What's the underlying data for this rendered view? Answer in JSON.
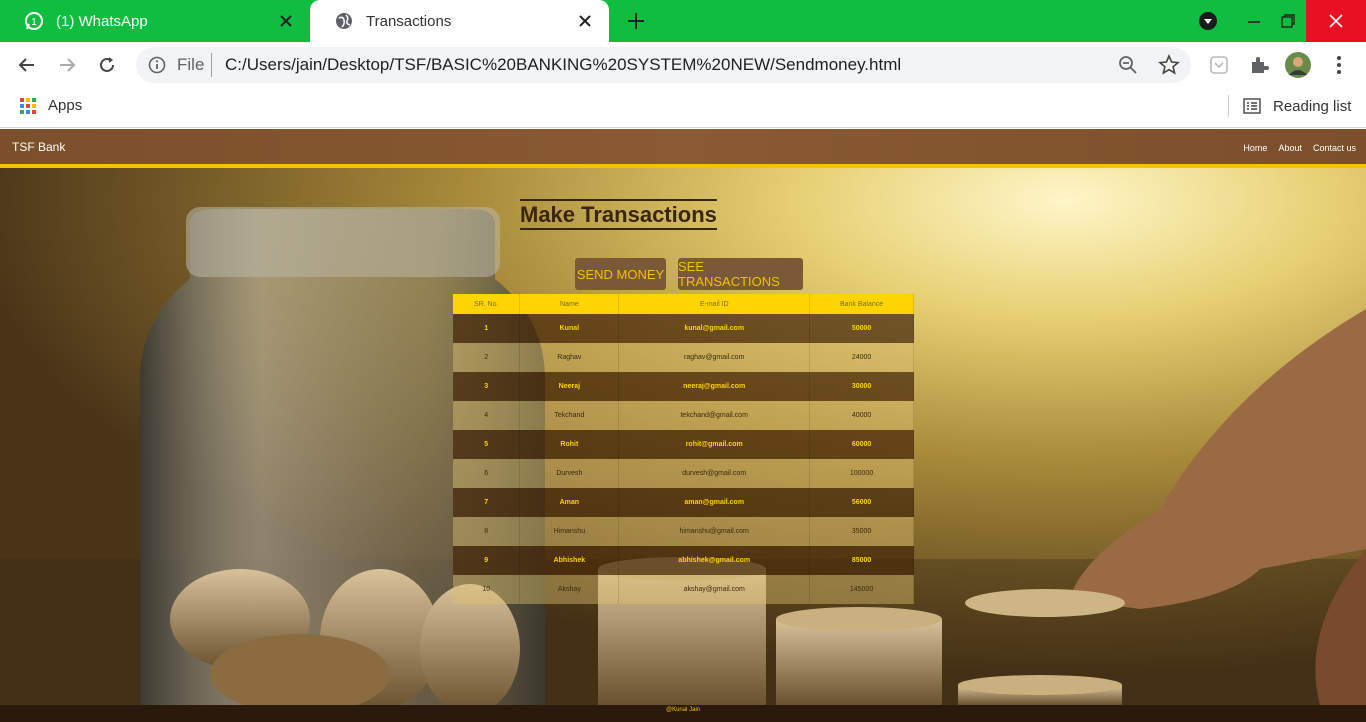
{
  "browser": {
    "tabs": [
      {
        "title": "(1) WhatsApp",
        "active": false
      },
      {
        "title": "Transactions",
        "active": true
      }
    ],
    "address": {
      "scheme": "File",
      "url": "C:/Users/jain/Desktop/TSF/BASIC%20BANKING%20SYSTEM%20NEW/Sendmoney.html"
    },
    "bookmarks": {
      "apps_label": "Apps",
      "reading_list_label": "Reading list"
    }
  },
  "site": {
    "brand": "TSF Bank",
    "nav": [
      "Home",
      "About",
      "Contact us"
    ],
    "heading": "Make Transactions",
    "buttons": {
      "send": "SEND MONEY",
      "see": "SEE TRANSACTIONS"
    },
    "table": {
      "headers": [
        "SR. No.",
        "Name",
        "E-mail ID",
        "Bank Balance"
      ],
      "rows": [
        [
          "1",
          "Kunal",
          "kunal@gmail.com",
          "50000"
        ],
        [
          "2",
          "Raghav",
          "raghav@gmail.com",
          "24000"
        ],
        [
          "3",
          "Neeraj",
          "neeraj@gmail.com",
          "30000"
        ],
        [
          "4",
          "Tekchand",
          "tekchand@gmail.com",
          "40000"
        ],
        [
          "5",
          "Rohit",
          "rohit@gmail.com",
          "60000"
        ],
        [
          "6",
          "Durvesh",
          "durvesh@gmail.com",
          "100000"
        ],
        [
          "7",
          "Aman",
          "aman@gmail.com",
          "56000"
        ],
        [
          "8",
          "Himanshu",
          "himanshu@gmail.com",
          "35000"
        ],
        [
          "9",
          "Abhishek",
          "abhishek@gmail.com",
          "85000"
        ],
        [
          "10",
          "Akshay",
          "akshay@gmail.com",
          "145000"
        ]
      ]
    },
    "footer": "@Kunal Jain"
  },
  "colors": {
    "tabbar": "#0fbd40",
    "navbar": "#7a4f2a",
    "accent": "#ffd400"
  }
}
